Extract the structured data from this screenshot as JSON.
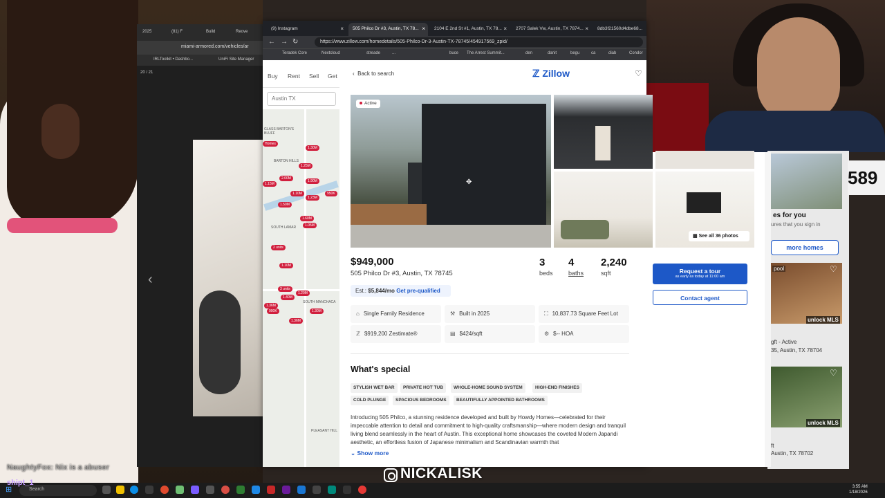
{
  "browser": {
    "tabs": [
      {
        "label": "(9) Instagram",
        "active": false
      },
      {
        "label": "505 Philco Dr #3, Austin, TX 78...",
        "active": true
      },
      {
        "label": "2104 E 2nd St #1, Austin, TX 78...",
        "active": false
      },
      {
        "label": "2707 Salek Vw, Austin, TX 7874...",
        "active": false
      },
      {
        "label": "8db3f21560d4dbe68...",
        "active": false
      }
    ],
    "url": "https://www.zillow.com/homedetails/505-Philco-Dr-3-Austin-TX-78745/454917569_zpid/",
    "bookmarks": [
      "Teradek Core",
      "Nextcloud",
      "streade",
      "...",
      "buce",
      "The Arrest Summit...",
      "den",
      "danit",
      "begu",
      "ca",
      "diab",
      "Condor"
    ]
  },
  "bg_window": {
    "tabs": [
      "2025",
      "(81) F",
      "Build",
      "Reove"
    ],
    "url": "miami-armored.com/vehicles/ar",
    "bookmarks": [
      "IRLToolkit • Dashbo...",
      "UniFi Site Manager"
    ],
    "counter": "20 / 21"
  },
  "zillow_bg": {
    "nav": [
      "Buy",
      "Rent",
      "Sell",
      "Get"
    ],
    "search": "Austin TX",
    "map_labels": [
      "GLASS BARTON'S BLUFF",
      "BARTON HILLS",
      "SOUTH LAMAR",
      "SOUTH MANCHACA",
      "PLEASANT HILL"
    ],
    "pins": [
      "1.30M",
      "1.25M",
      "2.00M",
      "1.90M",
      "1.15M",
      "1.10M",
      "1.50M",
      "1.23M",
      "1.60M",
      "950K",
      "1.05M",
      "2 units",
      "1.10M",
      "3 units",
      "1.40M",
      "1.20M",
      "1.36M",
      "900K",
      "1.30M",
      "1.36M"
    ],
    "homes_label": "Homes"
  },
  "listing": {
    "back_label": "Back to search",
    "logo": "Zillow",
    "status": "Active",
    "see_all": "See all 36 photos",
    "price": "$949,000",
    "address": "505 Philco Dr #3, Austin, TX 78745",
    "beds": "3",
    "beds_label": "beds",
    "baths": "4",
    "baths_label": "baths",
    "sqft": "2,240",
    "sqft_label": "sqft",
    "est_label": "Est.:",
    "est_value": "$5,844/mo",
    "prequal": "Get pre-qualified",
    "facts": [
      {
        "icon": "house-icon",
        "text": "Single Family Residence"
      },
      {
        "icon": "hammer-icon",
        "text": "Built in 2025"
      },
      {
        "icon": "lot-icon",
        "text": "10,837.73 Square Feet Lot"
      },
      {
        "icon": "zestimate-icon",
        "text": "$919,200 Zestimate®"
      },
      {
        "icon": "ruler-icon",
        "text": "$424/sqft"
      },
      {
        "icon": "hoa-icon",
        "text": "$-- HOA"
      }
    ],
    "special_heading": "What's special",
    "chips": [
      "STYLISH WET BAR",
      "PRIVATE HOT TUB",
      "WHOLE-HOME SOUND SYSTEM",
      "HIGH-END FINISHES",
      "COLD PLUNGE",
      "SPACIOUS BEDROOMS",
      "BEAUTIFULLY APPOINTED BATHROOMS"
    ],
    "description": "Introducing 505 Philco, a stunning residence developed and built by Howdy Homes—celebrated for their impeccable attention to detail and commitment to high-quality craftsmanship—where modern design and tranquil living blend seamlessly in the heart of Austin. This exceptional home showcases the coveted Modern Japandi aesthetic, an effortless fusion of Japanese minimalism and Scandinavian warmth that",
    "show_more": "Show more",
    "tour_label": "Request a tour",
    "tour_sub": "as early as today at 11:00 am",
    "agent_label": "Contact agent"
  },
  "right_side": {
    "homes_for_you": "es for you",
    "homes_sub": "ures that you sign in",
    "more_homes": "more homes",
    "number": "589",
    "pool": "pool",
    "unlock1": "unlock MLS",
    "unlock2": "unlock MLS",
    "item1_status": "gft - Active",
    "item1_addr": "35, Austin, TX 78704",
    "item2_status": "ft",
    "item2_addr": "Austin, TX 78702"
  },
  "stream": {
    "handle": "NICKALISK",
    "chat_line": "NaughtyFox: Nix is a abuser",
    "chat_user": "shipt_1"
  },
  "taskbar": {
    "search": "Search",
    "time": "3:55 AM",
    "date": "1/18/2026"
  },
  "colors": {
    "zillow_blue": "#1d58c7",
    "pin_red": "#d11f3d"
  }
}
